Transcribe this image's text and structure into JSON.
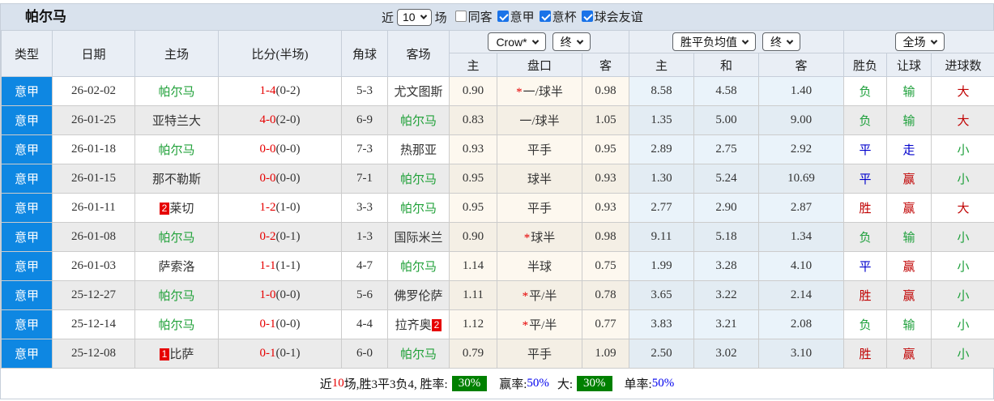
{
  "colors": {
    "league_badge_bg": "#0e87e2",
    "highlight_team": "#21a13a",
    "score_red": "#e60000",
    "result_red": "#c00000",
    "result_blue": "#0000cc",
    "result_green": "#1fa03c",
    "card_badge_bg": "#e60000",
    "rate_badge_bg": "#008000",
    "rate_text_blue": "#0000ee"
  },
  "topbar": {
    "title": "帕尔马",
    "recent_label": "近",
    "recent_value": "10",
    "games_label": "场",
    "checkboxes": [
      {
        "label": "同客",
        "checked": false
      },
      {
        "label": "意甲",
        "checked": true
      },
      {
        "label": "意杯",
        "checked": true
      },
      {
        "label": "球会友谊",
        "checked": true
      }
    ]
  },
  "header": {
    "left_columns": [
      "类型",
      "日期",
      "主场",
      "比分(半场)",
      "角球",
      "客场"
    ],
    "odds_dropdowns": [
      "Crow*",
      "终"
    ],
    "avg_dropdowns": [
      "胜平负均值",
      "终"
    ],
    "full_dropdown": "全场",
    "sub_columns": [
      "主",
      "盘口",
      "客",
      "主",
      "和",
      "客",
      "胜负",
      "让球",
      "进球数"
    ]
  },
  "rows": [
    {
      "league": "意甲",
      "date": "26-02-02",
      "home": {
        "name": "帕尔马",
        "highlight": true
      },
      "score": {
        "main": "1-4",
        "half": "(0-2)"
      },
      "corner": "5-3",
      "away": {
        "name": "尤文图斯",
        "highlight": false
      },
      "odds": {
        "home": "0.90",
        "star": true,
        "handicap": "一/球半",
        "away": "0.98"
      },
      "avg": {
        "home": "8.58",
        "draw": "4.58",
        "away": "1.40"
      },
      "result": {
        "outcome": "负",
        "outcome_color": "green",
        "handicap": "输",
        "handicap_color": "green",
        "goals": "大",
        "goals_color": "red"
      }
    },
    {
      "league": "意甲",
      "date": "26-01-25",
      "home": {
        "name": "亚特兰大",
        "highlight": false
      },
      "score": {
        "main": "4-0",
        "half": "(2-0)"
      },
      "corner": "6-9",
      "away": {
        "name": "帕尔马",
        "highlight": true
      },
      "odds": {
        "home": "0.83",
        "star": false,
        "handicap": "一/球半",
        "away": "1.05"
      },
      "avg": {
        "home": "1.35",
        "draw": "5.00",
        "away": "9.00"
      },
      "result": {
        "outcome": "负",
        "outcome_color": "green",
        "handicap": "输",
        "handicap_color": "green",
        "goals": "大",
        "goals_color": "red"
      }
    },
    {
      "league": "意甲",
      "date": "26-01-18",
      "home": {
        "name": "帕尔马",
        "highlight": true
      },
      "score": {
        "main": "0-0",
        "half": "(0-0)"
      },
      "corner": "7-3",
      "away": {
        "name": "热那亚",
        "highlight": false
      },
      "odds": {
        "home": "0.93",
        "star": false,
        "handicap": "平手",
        "away": "0.95"
      },
      "avg": {
        "home": "2.89",
        "draw": "2.75",
        "away": "2.92"
      },
      "result": {
        "outcome": "平",
        "outcome_color": "blue",
        "handicap": "走",
        "handicap_color": "blue",
        "goals": "小",
        "goals_color": "green"
      }
    },
    {
      "league": "意甲",
      "date": "26-01-15",
      "home": {
        "name": "那不勒斯",
        "highlight": false
      },
      "score": {
        "main": "0-0",
        "half": "(0-0)"
      },
      "corner": "7-1",
      "away": {
        "name": "帕尔马",
        "highlight": true
      },
      "odds": {
        "home": "0.95",
        "star": false,
        "handicap": "球半",
        "away": "0.93"
      },
      "avg": {
        "home": "1.30",
        "draw": "5.24",
        "away": "10.69"
      },
      "result": {
        "outcome": "平",
        "outcome_color": "blue",
        "handicap": "赢",
        "handicap_color": "red",
        "goals": "小",
        "goals_color": "green"
      }
    },
    {
      "league": "意甲",
      "date": "26-01-11",
      "home": {
        "name": "莱切",
        "highlight": false,
        "badge_before": "2"
      },
      "score": {
        "main": "1-2",
        "half": "(1-0)"
      },
      "corner": "3-3",
      "away": {
        "name": "帕尔马",
        "highlight": true
      },
      "odds": {
        "home": "0.95",
        "star": false,
        "handicap": "平手",
        "away": "0.93"
      },
      "avg": {
        "home": "2.77",
        "draw": "2.90",
        "away": "2.87"
      },
      "result": {
        "outcome": "胜",
        "outcome_color": "red",
        "handicap": "赢",
        "handicap_color": "red",
        "goals": "大",
        "goals_color": "red"
      }
    },
    {
      "league": "意甲",
      "date": "26-01-08",
      "home": {
        "name": "帕尔马",
        "highlight": true
      },
      "score": {
        "main": "0-2",
        "half": "(0-1)"
      },
      "corner": "1-3",
      "away": {
        "name": "国际米兰",
        "highlight": false
      },
      "odds": {
        "home": "0.90",
        "star": true,
        "handicap": "球半",
        "away": "0.98"
      },
      "avg": {
        "home": "9.11",
        "draw": "5.18",
        "away": "1.34"
      },
      "result": {
        "outcome": "负",
        "outcome_color": "green",
        "handicap": "输",
        "handicap_color": "green",
        "goals": "小",
        "goals_color": "green"
      }
    },
    {
      "league": "意甲",
      "date": "26-01-03",
      "home": {
        "name": "萨索洛",
        "highlight": false
      },
      "score": {
        "main": "1-1",
        "half": "(1-1)"
      },
      "corner": "4-7",
      "away": {
        "name": "帕尔马",
        "highlight": true
      },
      "odds": {
        "home": "1.14",
        "star": false,
        "handicap": "半球",
        "away": "0.75"
      },
      "avg": {
        "home": "1.99",
        "draw": "3.28",
        "away": "4.10"
      },
      "result": {
        "outcome": "平",
        "outcome_color": "blue",
        "handicap": "赢",
        "handicap_color": "red",
        "goals": "小",
        "goals_color": "green"
      }
    },
    {
      "league": "意甲",
      "date": "25-12-27",
      "home": {
        "name": "帕尔马",
        "highlight": true
      },
      "score": {
        "main": "1-0",
        "half": "(0-0)"
      },
      "corner": "5-6",
      "away": {
        "name": "佛罗伦萨",
        "highlight": false
      },
      "odds": {
        "home": "1.11",
        "star": true,
        "handicap": "平/半",
        "away": "0.78"
      },
      "avg": {
        "home": "3.65",
        "draw": "3.22",
        "away": "2.14"
      },
      "result": {
        "outcome": "胜",
        "outcome_color": "red",
        "handicap": "赢",
        "handicap_color": "red",
        "goals": "小",
        "goals_color": "green"
      }
    },
    {
      "league": "意甲",
      "date": "25-12-14",
      "home": {
        "name": "帕尔马",
        "highlight": true
      },
      "score": {
        "main": "0-1",
        "half": "(0-0)"
      },
      "corner": "4-4",
      "away": {
        "name": "拉齐奥",
        "highlight": false,
        "badge_after": "2"
      },
      "odds": {
        "home": "1.12",
        "star": true,
        "handicap": "平/半",
        "away": "0.77"
      },
      "avg": {
        "home": "3.83",
        "draw": "3.21",
        "away": "2.08"
      },
      "result": {
        "outcome": "负",
        "outcome_color": "green",
        "handicap": "输",
        "handicap_color": "green",
        "goals": "小",
        "goals_color": "green"
      }
    },
    {
      "league": "意甲",
      "date": "25-12-08",
      "home": {
        "name": "比萨",
        "highlight": false,
        "badge_before": "1"
      },
      "score": {
        "main": "0-1",
        "half": "(0-1)"
      },
      "corner": "6-0",
      "away": {
        "name": "帕尔马",
        "highlight": true
      },
      "odds": {
        "home": "0.79",
        "star": false,
        "handicap": "平手",
        "away": "1.09"
      },
      "avg": {
        "home": "2.50",
        "draw": "3.02",
        "away": "3.10"
      },
      "result": {
        "outcome": "胜",
        "outcome_color": "red",
        "handicap": "赢",
        "handicap_color": "red",
        "goals": "小",
        "goals_color": "green"
      }
    }
  ],
  "footer": {
    "prefix": "近",
    "count": "10",
    "summary": "场,胜3平3负4, 胜率:",
    "win_rate": "30%",
    "handicap_label": "赢率:",
    "handicap_rate": "50%",
    "big_label": "大:",
    "big_rate": "30%",
    "single_label": "单率:",
    "single_rate": "50%"
  }
}
